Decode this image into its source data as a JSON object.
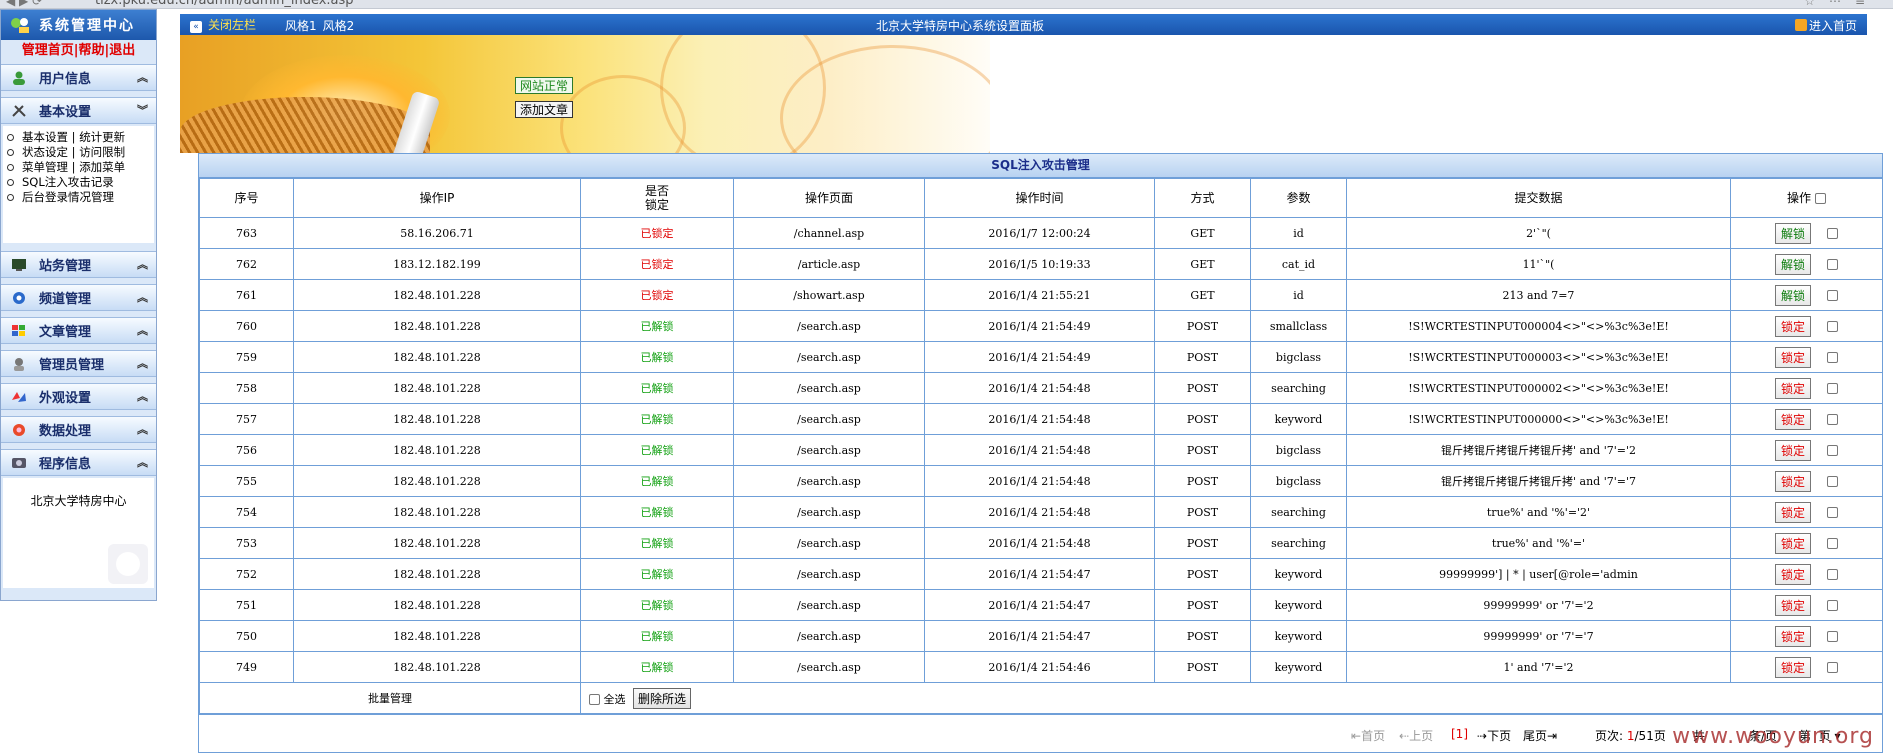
{
  "browser": {
    "url": "tizx.pku.edu.cn/admin/admin_index.asp"
  },
  "sidebar": {
    "title": "系统管理中心",
    "links": [
      "管理首页",
      "帮助",
      "退出"
    ],
    "sections": [
      {
        "label": "用户信息",
        "icon": "user-icon"
      },
      {
        "label": "基本设置",
        "icon": "tools-icon"
      },
      {
        "label": "站务管理",
        "icon": "monitor-icon"
      },
      {
        "label": "频道管理",
        "icon": "channel-icon"
      },
      {
        "label": "文章管理",
        "icon": "article-icon"
      },
      {
        "label": "管理员管理",
        "icon": "admin-icon"
      },
      {
        "label": "外观设置",
        "icon": "appearance-icon"
      },
      {
        "label": "数据处理",
        "icon": "data-icon"
      },
      {
        "label": "程序信息",
        "icon": "info-icon"
      }
    ],
    "basic_items": [
      [
        "基本设置",
        "统计更新"
      ],
      [
        "状态设定",
        "访问限制"
      ],
      [
        "菜单管理",
        "添加菜单"
      ],
      [
        "SQL注入攻击记录"
      ],
      [
        "后台登录情况管理"
      ]
    ],
    "info_text": "北京大学特房中心"
  },
  "topbar": {
    "close_left": "关闭左栏",
    "styles": [
      "风格1",
      "风格2"
    ],
    "title": "北京大学特房中心系统设置面板",
    "enter": "进入首页"
  },
  "banner": {
    "status_button": "网站正常",
    "add_article_button": "添加文章"
  },
  "panel": {
    "title": "SQL注入攻击管理",
    "headers": {
      "id": "序号",
      "ip": "操作IP",
      "locked_1": "是否",
      "locked_2": "锁定",
      "page": "操作页面",
      "time": "操作时间",
      "method": "方式",
      "param": "参数",
      "data": "提交数据",
      "action": "操作"
    },
    "rows": [
      {
        "id": "763",
        "ip": "58.16.206.71",
        "status": "已锁定",
        "locked": true,
        "page": "/channel.asp",
        "time": "2016/1/7 12:00:24",
        "method": "GET",
        "param": "id",
        "data": "2'`\"(",
        "action": "解锁"
      },
      {
        "id": "762",
        "ip": "183.12.182.199",
        "status": "已锁定",
        "locked": true,
        "page": "/article.asp",
        "time": "2016/1/5 10:19:33",
        "method": "GET",
        "param": "cat_id",
        "data": "11'`\"(",
        "action": "解锁"
      },
      {
        "id": "761",
        "ip": "182.48.101.228",
        "status": "已锁定",
        "locked": true,
        "page": "/showart.asp",
        "time": "2016/1/4 21:55:21",
        "method": "GET",
        "param": "id",
        "data": "213 and 7=7",
        "action": "解锁"
      },
      {
        "id": "760",
        "ip": "182.48.101.228",
        "status": "已解锁",
        "locked": false,
        "page": "/search.asp",
        "time": "2016/1/4 21:54:49",
        "method": "POST",
        "param": "smallclass",
        "data": "!S!WCRTESTINPUT000004<>\"<>%3c%3e!E!",
        "action": "锁定"
      },
      {
        "id": "759",
        "ip": "182.48.101.228",
        "status": "已解锁",
        "locked": false,
        "page": "/search.asp",
        "time": "2016/1/4 21:54:49",
        "method": "POST",
        "param": "bigclass",
        "data": "!S!WCRTESTINPUT000003<>\"<>%3c%3e!E!",
        "action": "锁定"
      },
      {
        "id": "758",
        "ip": "182.48.101.228",
        "status": "已解锁",
        "locked": false,
        "page": "/search.asp",
        "time": "2016/1/4 21:54:48",
        "method": "POST",
        "param": "searching",
        "data": "!S!WCRTESTINPUT000002<>\"<>%3c%3e!E!",
        "action": "锁定"
      },
      {
        "id": "757",
        "ip": "182.48.101.228",
        "status": "已解锁",
        "locked": false,
        "page": "/search.asp",
        "time": "2016/1/4 21:54:48",
        "method": "POST",
        "param": "keyword",
        "data": "!S!WCRTESTINPUT000000<>\"<>%3c%3e!E!",
        "action": "锁定"
      },
      {
        "id": "756",
        "ip": "182.48.101.228",
        "status": "已解锁",
        "locked": false,
        "page": "/search.asp",
        "time": "2016/1/4 21:54:48",
        "method": "POST",
        "param": "bigclass",
        "data": "锟斤拷锟斤拷锟斤拷锟斤拷' and '7'='2",
        "action": "锁定"
      },
      {
        "id": "755",
        "ip": "182.48.101.228",
        "status": "已解锁",
        "locked": false,
        "page": "/search.asp",
        "time": "2016/1/4 21:54:48",
        "method": "POST",
        "param": "bigclass",
        "data": "锟斤拷锟斤拷锟斤拷锟斤拷' and '7'='7",
        "action": "锁定"
      },
      {
        "id": "754",
        "ip": "182.48.101.228",
        "status": "已解锁",
        "locked": false,
        "page": "/search.asp",
        "time": "2016/1/4 21:54:48",
        "method": "POST",
        "param": "searching",
        "data": "true%' and '%'='2'",
        "action": "锁定"
      },
      {
        "id": "753",
        "ip": "182.48.101.228",
        "status": "已解锁",
        "locked": false,
        "page": "/search.asp",
        "time": "2016/1/4 21:54:48",
        "method": "POST",
        "param": "searching",
        "data": "true%' and '%'='",
        "action": "锁定"
      },
      {
        "id": "752",
        "ip": "182.48.101.228",
        "status": "已解锁",
        "locked": false,
        "page": "/search.asp",
        "time": "2016/1/4 21:54:47",
        "method": "POST",
        "param": "keyword",
        "data": "99999999'] | * | user[@role='admin",
        "action": "锁定"
      },
      {
        "id": "751",
        "ip": "182.48.101.228",
        "status": "已解锁",
        "locked": false,
        "page": "/search.asp",
        "time": "2016/1/4 21:54:47",
        "method": "POST",
        "param": "keyword",
        "data": "99999999' or '7'='2",
        "action": "锁定"
      },
      {
        "id": "750",
        "ip": "182.48.101.228",
        "status": "已解锁",
        "locked": false,
        "page": "/search.asp",
        "time": "2016/1/4 21:54:47",
        "method": "POST",
        "param": "keyword",
        "data": "99999999' or '7'='7",
        "action": "锁定"
      },
      {
        "id": "749",
        "ip": "182.48.101.228",
        "status": "已解锁",
        "locked": false,
        "page": "/search.asp",
        "time": "2016/1/4 21:54:46",
        "method": "POST",
        "param": "keyword",
        "data": "1' and '7'='2",
        "action": "锁定"
      }
    ],
    "batch": {
      "label": "批量管理",
      "select_all": "全选",
      "delete_selected": "删除所选"
    },
    "pager": {
      "first": "首页",
      "prev": "上页",
      "current": "[1]",
      "next": "下页",
      "last": "尾页",
      "page_label": "页次:",
      "page_current": "1",
      "page_total": "/51页",
      "total": "共",
      "per_page": "条/页",
      "goto": "第",
      "goto_suffix": "页"
    },
    "watermark": "www.wooyun.org"
  },
  "colors": {
    "locked": "#e00000",
    "unlocked": "#10a010",
    "header_blue": "#1a55ad",
    "border_blue": "#6f9fd8"
  }
}
